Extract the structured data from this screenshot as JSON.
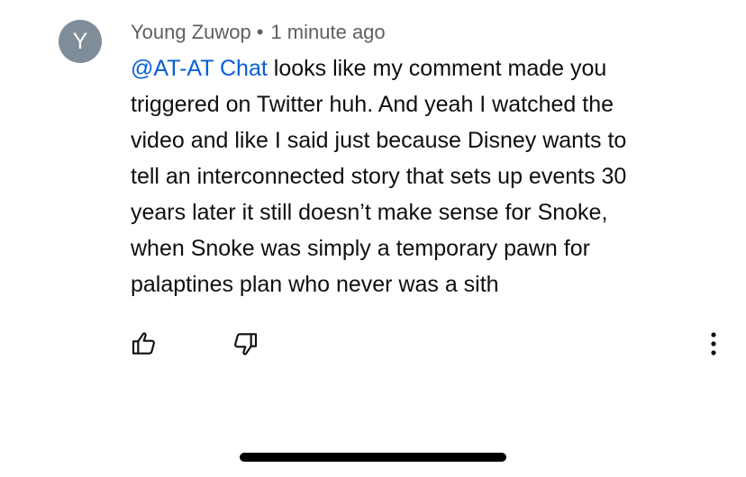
{
  "comment": {
    "author": "Young Zuwop",
    "separator": "•",
    "timestamp": "1 minute ago",
    "avatar": {
      "initial": "Y",
      "color": "#7f8c99"
    },
    "mention": "@AT-AT Chat",
    "lines": [
      " looks like my comment made you",
      "triggered on Twitter huh. And yeah I watched the",
      "video and like I said just because Disney wants to",
      "tell an interconnected story that sets up events 30",
      "years later it still doesn’t make sense for Snoke,",
      "when Snoke was simply a temporary pawn for",
      "palaptines plan who never was a sith"
    ]
  },
  "actions": {
    "like_icon": "thumbs-up-icon",
    "dislike_icon": "thumbs-down-icon",
    "more_icon": "more-vertical-icon"
  },
  "colors": {
    "mention": "#065fd4",
    "meta_text": "#606060",
    "body_text": "#0f0f0f"
  }
}
